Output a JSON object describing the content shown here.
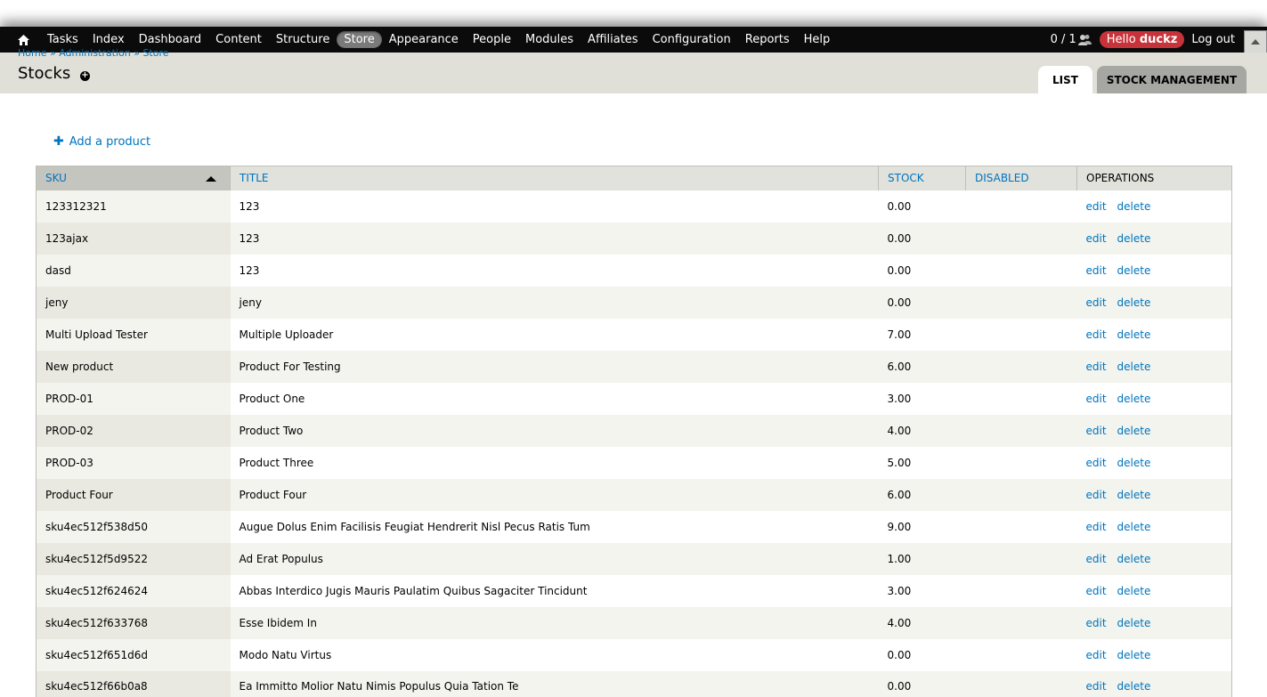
{
  "toolbar": {
    "menu": [
      "Tasks",
      "Index",
      "Dashboard",
      "Content",
      "Structure",
      "Store",
      "Appearance",
      "People",
      "Modules",
      "Affiliates",
      "Configuration",
      "Reports",
      "Help"
    ],
    "active_item": "Store",
    "user_count": "0 / 1",
    "hello_prefix": "Hello",
    "username": "duckz",
    "logout": "Log out"
  },
  "breadcrumb": [
    "Home",
    "Administration",
    "Store"
  ],
  "breadcrumb_separator": "»",
  "page": {
    "title": "Stocks",
    "shortcut_symbol": "+"
  },
  "tabs": [
    {
      "label": "List",
      "active": true
    },
    {
      "label": "Stock management",
      "active": false
    }
  ],
  "actions": {
    "add_product": "Add a product"
  },
  "table": {
    "headers": [
      "SKU",
      "Title",
      "Stock",
      "Disabled",
      "Operations"
    ],
    "sorted_column": "SKU",
    "sort_direction": "asc",
    "rows": [
      {
        "sku": "123312321",
        "title": "123",
        "stock": "0.00",
        "disabled": "",
        "edit": "edit",
        "delete": "delete"
      },
      {
        "sku": "123ajax",
        "title": "123",
        "stock": "0.00",
        "disabled": "",
        "edit": "edit",
        "delete": "delete"
      },
      {
        "sku": "dasd",
        "title": "123",
        "stock": "0.00",
        "disabled": "",
        "edit": "edit",
        "delete": "delete"
      },
      {
        "sku": "jeny",
        "title": "jeny",
        "stock": "0.00",
        "disabled": "",
        "edit": "edit",
        "delete": "delete"
      },
      {
        "sku": "Multi Upload Tester",
        "title": "Multiple Uploader",
        "stock": "7.00",
        "disabled": "",
        "edit": "edit",
        "delete": "delete"
      },
      {
        "sku": "New product",
        "title": "Product For Testing",
        "stock": "6.00",
        "disabled": "",
        "edit": "edit",
        "delete": "delete"
      },
      {
        "sku": "PROD-01",
        "title": "Product One",
        "stock": "3.00",
        "disabled": "",
        "edit": "edit",
        "delete": "delete"
      },
      {
        "sku": "PROD-02",
        "title": "Product Two",
        "stock": "4.00",
        "disabled": "",
        "edit": "edit",
        "delete": "delete"
      },
      {
        "sku": "PROD-03",
        "title": "Product Three",
        "stock": "5.00",
        "disabled": "",
        "edit": "edit",
        "delete": "delete"
      },
      {
        "sku": "Product Four",
        "title": "Product Four",
        "stock": "6.00",
        "disabled": "",
        "edit": "edit",
        "delete": "delete"
      },
      {
        "sku": "sku4ec512f538d50",
        "title": "Augue Dolus Enim Facilisis Feugiat Hendrerit Nisl Pecus Ratis Tum",
        "stock": "9.00",
        "disabled": "",
        "edit": "edit",
        "delete": "delete"
      },
      {
        "sku": "sku4ec512f5d9522",
        "title": "Ad Erat Populus",
        "stock": "1.00",
        "disabled": "",
        "edit": "edit",
        "delete": "delete"
      },
      {
        "sku": "sku4ec512f624624",
        "title": "Abbas Interdico Jugis Mauris Paulatim Quibus Sagaciter Tincidunt",
        "stock": "3.00",
        "disabled": "",
        "edit": "edit",
        "delete": "delete"
      },
      {
        "sku": "sku4ec512f633768",
        "title": "Esse Ibidem In",
        "stock": "4.00",
        "disabled": "",
        "edit": "edit",
        "delete": "delete"
      },
      {
        "sku": "sku4ec512f651d6d",
        "title": "Modo Natu Virtus",
        "stock": "0.00",
        "disabled": "",
        "edit": "edit",
        "delete": "delete"
      },
      {
        "sku": "sku4ec512f66b0a8",
        "title": "Ea Immitto Molior Natu Nimis Populus Quia Tation Te",
        "stock": "0.00",
        "disabled": "",
        "edit": "edit",
        "delete": "delete"
      }
    ]
  },
  "colors": {
    "toolbar_bg": "#0b0b0b",
    "link": "#0074bd",
    "hello_badge": "#c7333a",
    "header_bg": "#e0e0d8"
  }
}
